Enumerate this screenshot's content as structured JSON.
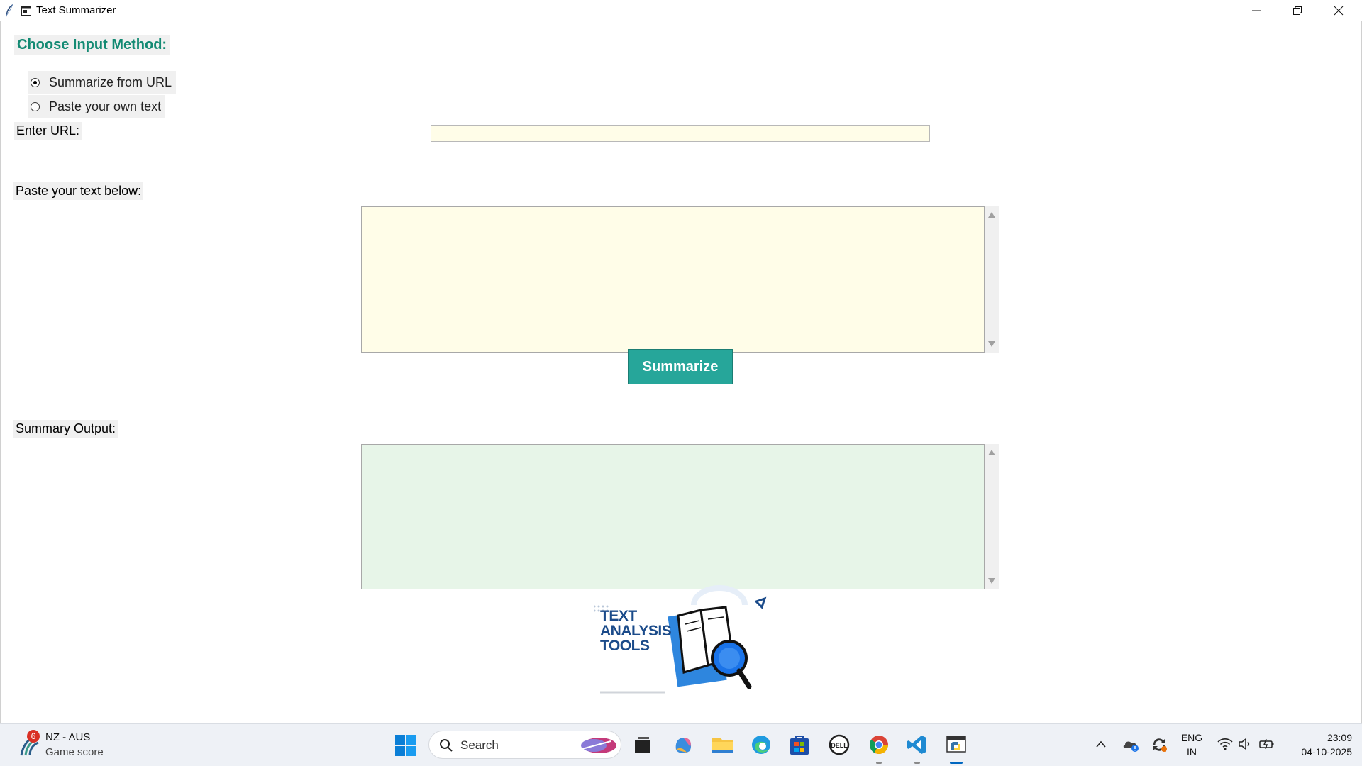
{
  "window": {
    "title": "Text Summarizer"
  },
  "form": {
    "heading": "Choose Input Method:",
    "radio_url": "Summarize from URL",
    "radio_text": "Paste your own text",
    "selected": "url",
    "url_label": "Enter URL:",
    "url_value": "",
    "text_label": "Paste your text below:",
    "text_value": "",
    "button_label": "Summarize",
    "output_label": "Summary Output:",
    "output_value": ""
  },
  "logo": {
    "line1": "TEXT",
    "line2": "ANALYSIS",
    "line3": "TOOLS"
  },
  "colors": {
    "heading": "#138a73",
    "button": "#26a69a",
    "input_bg": "#fffde8",
    "output_bg": "#e7f5e8"
  },
  "taskbar": {
    "widget_badge": "6",
    "widget_title": "NZ - AUS",
    "widget_subtitle": "Game score",
    "search_placeholder": "Search",
    "lang_top": "ENG",
    "lang_bottom": "IN",
    "time": "23:09",
    "date": "04-10-2025"
  }
}
